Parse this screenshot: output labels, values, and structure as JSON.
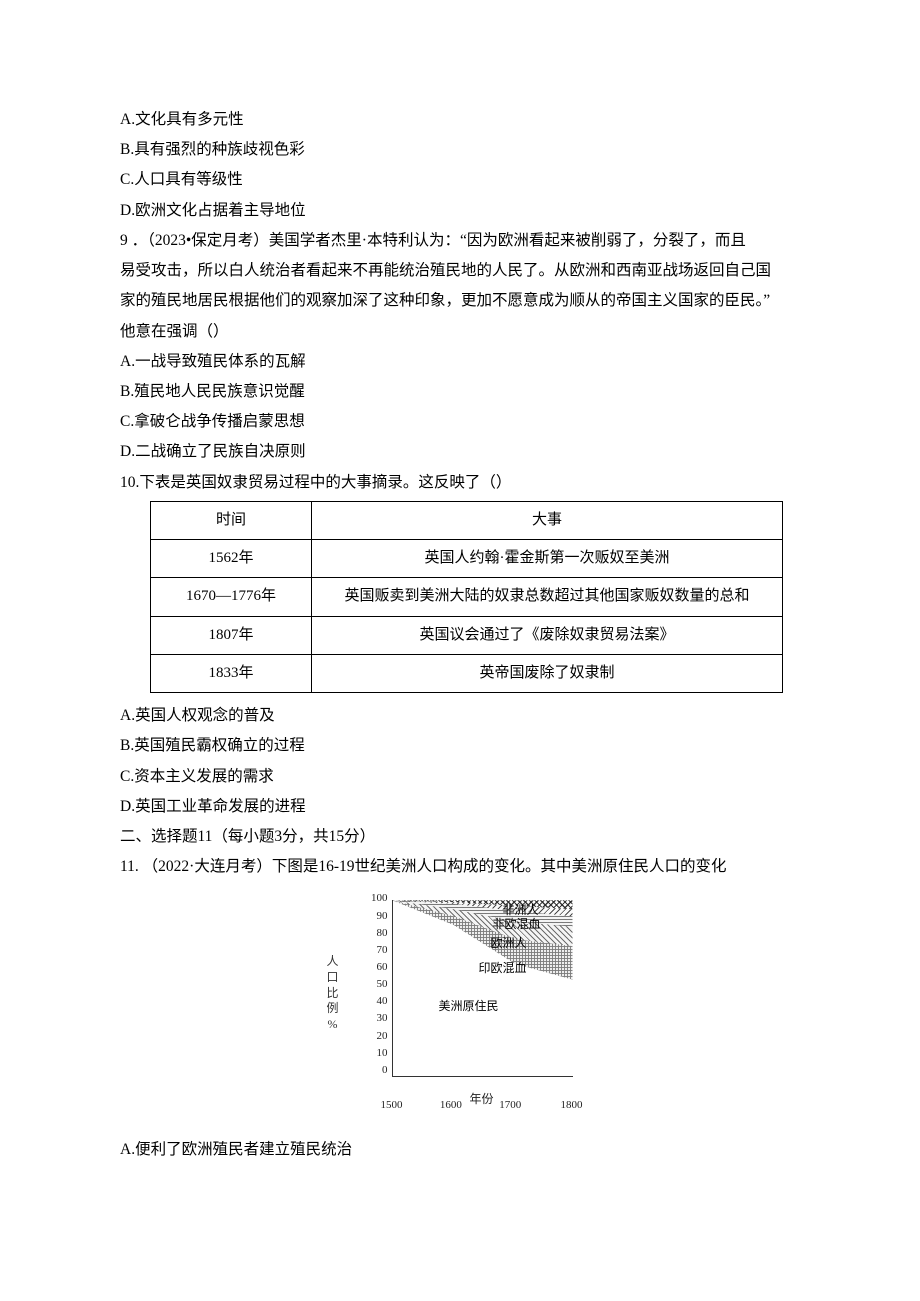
{
  "q8_options": {
    "a": "A.文化具有多元性",
    "b": "B.具有强烈的种族歧视色彩",
    "c": "C.人口具有等级性",
    "d": "D.欧洲文化占据着主导地位"
  },
  "q9": {
    "stem1": "9 ．（2023•保定月考）美国学者杰里·本特利认为：“因为欧洲看起来被削弱了，分裂了，而且",
    "stem2": "易受攻击，所以白人统治者看起来不再能统治殖民地的人民了。从欧洲和西南亚战场返回自己国",
    "stem3": "家的殖民地居民根据他们的观察加深了这种印象，更加不愿意成为顺从的帝国主义国家的臣民。”",
    "stem4": "他意在强调（）",
    "a": "A.一战导致殖民体系的瓦解",
    "b": "B.殖民地人民民族意识觉醒",
    "c": "C.拿破仑战争传播启蒙思想",
    "d": "D.二战确立了民族自决原则"
  },
  "q10": {
    "stem": "10.下表是英国奴隶贸易过程中的大事摘录。这反映了（）",
    "table": {
      "header_time": "时间",
      "header_event": "大事",
      "rows": [
        {
          "time": "1562年",
          "event": "英国人约翰·霍金斯第一次贩奴至美洲"
        },
        {
          "time": "1670—1776年",
          "event": "英国贩卖到美洲大陆的奴隶总数超过其他国家贩奴数量的总和"
        },
        {
          "time": "1807年",
          "event": "英国议会通过了《废除奴隶贸易法案》"
        },
        {
          "time": "1833年",
          "event": "英帝国废除了奴隶制"
        }
      ]
    },
    "a": "A.英国人权观念的普及",
    "b": "B.英国殖民霸权确立的过程",
    "c": "C.资本主义发展的需求",
    "d": "D.英国工业革命发展的进程"
  },
  "section2": "二、选择题11（每小题3分，共15分）",
  "q11": {
    "stem": "11.   （2022·大连月考）下图是16-19世纪美洲人口构成的变化。其中美洲原住民人口的变化",
    "a": "A.便利了欧洲殖民者建立殖民统治"
  },
  "chart_data": {
    "type": "area",
    "title": "",
    "xlabel": "年份",
    "ylabel": "人口比例 %",
    "xlim": [
      1500,
      1800
    ],
    "ylim": [
      0,
      100
    ],
    "x": [
      1500,
      1600,
      1700,
      1800
    ],
    "yticks": [
      0,
      10,
      20,
      30,
      40,
      50,
      60,
      70,
      80,
      90,
      100
    ],
    "series": [
      {
        "name": "美洲原住民",
        "values": [
          100,
          85,
          62,
          45
        ]
      },
      {
        "name": "印欧混血",
        "values": [
          0,
          5,
          14,
          22
        ]
      },
      {
        "name": "欧洲人",
        "values": [
          0,
          5,
          10,
          13
        ]
      },
      {
        "name": "非欧混血",
        "values": [
          0,
          2,
          6,
          8
        ]
      },
      {
        "name": "非洲人",
        "values": [
          0,
          3,
          8,
          12
        ]
      }
    ],
    "labels": {
      "native": "美洲原住民",
      "indoeuro": "印欧混血",
      "euro": "欧洲人",
      "afroeuro": "非欧混血",
      "african": "非洲人"
    }
  }
}
